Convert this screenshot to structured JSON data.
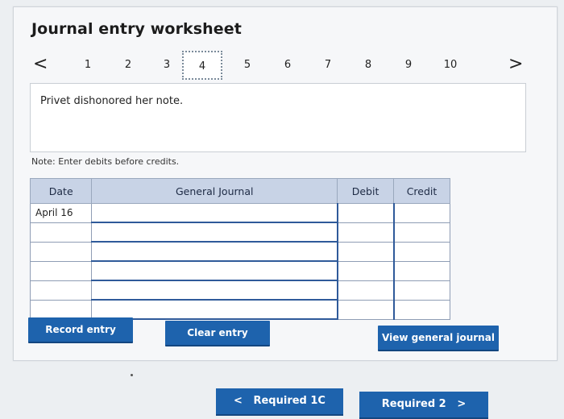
{
  "worksheet": {
    "title": "Journal entry worksheet",
    "pager": {
      "prev": "<",
      "next": ">",
      "pages": [
        "1",
        "2",
        "3",
        "4",
        "5",
        "6",
        "7",
        "8",
        "9",
        "10"
      ],
      "active_page": "4"
    },
    "prompt": "Privet dishonored her note.",
    "note": "Note: Enter debits before credits.",
    "table": {
      "headers": [
        "Date",
        "General Journal",
        "Debit",
        "Credit"
      ],
      "rows": [
        {
          "date": "April 16",
          "account": "",
          "debit": "",
          "credit": ""
        },
        {
          "date": "",
          "account": "",
          "debit": "",
          "credit": ""
        },
        {
          "date": "",
          "account": "",
          "debit": "",
          "credit": ""
        },
        {
          "date": "",
          "account": "",
          "debit": "",
          "credit": ""
        },
        {
          "date": "",
          "account": "",
          "debit": "",
          "credit": ""
        },
        {
          "date": "",
          "account": "",
          "debit": "",
          "credit": ""
        }
      ]
    },
    "buttons": {
      "record": "Record entry",
      "clear": "Clear entry",
      "view_journal": "View general journal"
    }
  },
  "footer": {
    "prev_required": "Required 1C",
    "next_required": "Required 2",
    "prev_arrow": "<",
    "next_arrow": ">"
  },
  "colors": {
    "button": "#1e63ad",
    "table_header": "#c8d3e6",
    "input_border": "#2f5a9a"
  }
}
